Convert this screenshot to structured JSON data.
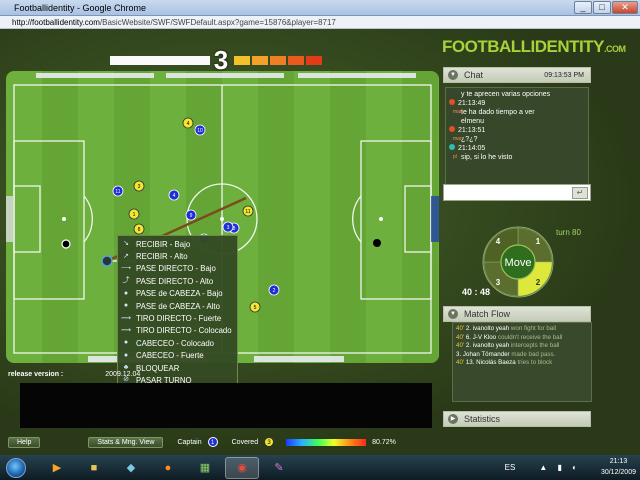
{
  "window": {
    "title": "Footballidentity - Google Chrome",
    "url_domain": "http://footballidentity.com",
    "url_path": "/BasicWebsite/SWF/SWFDefault.aspx?game=15876&player=8717"
  },
  "timer": {
    "countdown": "3",
    "segment_colors": [
      "#f2c12b",
      "#f2a22a",
      "#ef7f25",
      "#ea5a1f",
      "#e43a18"
    ]
  },
  "logo": {
    "main": "FOOTBALLIDENTITY",
    "suffix": ".COM"
  },
  "chat": {
    "title": "Chat",
    "time": "09:13:53 PM",
    "messages": [
      {
        "time": "",
        "nick": "",
        "text": "y te aprecen varias opciones",
        "type": "orange"
      },
      {
        "time": "21:13:49",
        "nick": "man",
        "text": "te ha dado tiempo a ver",
        "text2": "elmenu",
        "type": "orange"
      },
      {
        "time": "21:13:51",
        "nick": "man",
        "text": "¿?¿?",
        "type": "orange"
      },
      {
        "time": "21:14:05",
        "nick": "pl",
        "text": "sip, si lo he visto",
        "type": "teal"
      }
    ],
    "send_label": "↵"
  },
  "wheel": {
    "center_label": "Move",
    "n1": "1",
    "n2": "2",
    "n3": "3",
    "n4": "4",
    "turn": "turn 80",
    "score": "40 : 48"
  },
  "match_flow": {
    "title": "Match Flow",
    "entries": [
      {
        "min": "40'",
        "num": "2.",
        "player": "ivanolto yeah",
        "action": "won fight for ball"
      },
      {
        "min": "40'",
        "num": "6.",
        "player": "J-V Kloo",
        "action": "couldn't receive the ball"
      },
      {
        "min": "40'",
        "num": "2.",
        "player": "ivanolto yeah",
        "action": "intercepts the ball"
      },
      {
        "min": "",
        "num": "3.",
        "player": "Johan Tömander",
        "action": "made bad pass."
      },
      {
        "min": "40'",
        "num": "13.",
        "player": "Nicolás Baeza",
        "action": "tries to block"
      }
    ]
  },
  "statistics": {
    "title": "Statistics"
  },
  "context_menu": [
    {
      "label": "RECIBIR - Bajo",
      "icon": "receive-low-icon"
    },
    {
      "label": "RECIBIR - Alto",
      "icon": "receive-high-icon"
    },
    {
      "label": "PASE DIRECTO - Bajo",
      "icon": "pass-low-icon"
    },
    {
      "label": "PASE DIRECTO - Alto",
      "icon": "pass-high-icon"
    },
    {
      "label": "PASE de CABEZA - Bajo",
      "icon": "header-pass-low-icon"
    },
    {
      "label": "PASE de CABEZA - Alto",
      "icon": "header-pass-high-icon"
    },
    {
      "label": "TIRO DIRECTO - Fuerte",
      "icon": "shot-strong-icon"
    },
    {
      "label": "TIRO DIRECTO - Colocado",
      "icon": "shot-placed-icon"
    },
    {
      "label": "CABECEO - Colocado",
      "icon": "header-placed-icon"
    },
    {
      "label": "CABECEO - Fuerte",
      "icon": "header-strong-icon"
    },
    {
      "label": "BLOQUEAR",
      "icon": "block-icon"
    },
    {
      "label": "PASAR TURNO",
      "icon": "skip-turn-icon"
    }
  ],
  "release": {
    "label": "release version :",
    "value": "2009.12.04"
  },
  "bottom": {
    "help": "Help",
    "stats": "Stats & Mng. View",
    "captain": "Captain",
    "captain_no": "1",
    "covered": "Covered",
    "covered_no": "3",
    "pct": "80.72%"
  },
  "players": {
    "yellow": [
      {
        "n": "4"
      },
      {
        "n": "3"
      },
      {
        "n": "1"
      },
      {
        "n": "8"
      },
      {
        "n": "11"
      },
      {
        "n": "5"
      }
    ],
    "blue": [
      {
        "n": "10"
      },
      {
        "n": "11"
      },
      {
        "n": "4"
      },
      {
        "n": "8"
      },
      {
        "n": "7"
      },
      {
        "n": "2"
      },
      {
        "n": "3"
      },
      {
        "n": "9"
      }
    ]
  },
  "taskbar": {
    "lang": "ES",
    "time": "21:13",
    "date": "30/12/2009"
  },
  "colors": {
    "field_light": "#6db03d",
    "field_dark": "#64a536",
    "accent_green": "#a8d23a",
    "yellow_team": "#f2e632",
    "blue_team": "#1f2fd6"
  }
}
